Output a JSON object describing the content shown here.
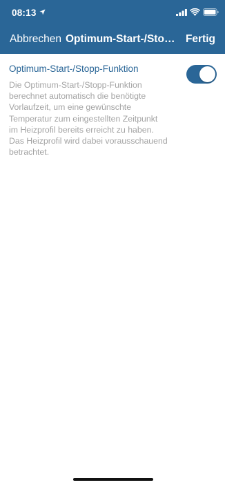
{
  "status_bar": {
    "time": "08:13",
    "icons": [
      "location-arrow-icon",
      "cellular-signal-icon",
      "wifi-icon",
      "battery-icon"
    ]
  },
  "nav": {
    "left_label": "Abbrechen",
    "title": "Optimum-Start-/Stopp-Funktion",
    "right_label": "Fertig"
  },
  "setting": {
    "title": "Optimum-Start-/Stopp-Funktion",
    "enabled": true,
    "description_lines": [
      "Die Optimum-Start-/Stopp-Funktion",
      "berechnet automatisch die benötigte",
      "Vorlaufzeit, um eine gewünschte",
      "Temperatur zum eingestellten Zeitpunkt",
      "im Heizprofil bereits erreicht zu haben.",
      "Das Heizprofil wird dabei vorausschauend",
      "betrachtet."
    ]
  },
  "colors": {
    "primary": "#2a6697",
    "description_text": "#a3a3a3",
    "background": "#ffffff"
  }
}
